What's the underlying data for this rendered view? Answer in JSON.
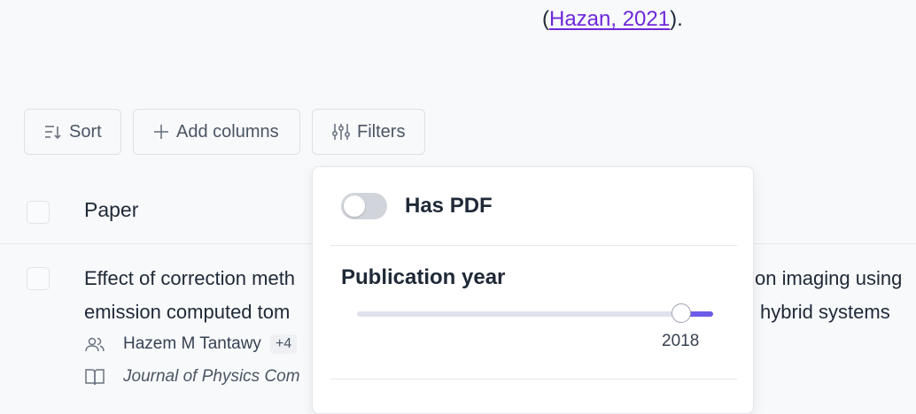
{
  "citation": {
    "open": "(",
    "link": "Hazan, 2021",
    "close": ")."
  },
  "toolbar": {
    "sort_label": "Sort",
    "add_columns_label": "Add columns",
    "filters_label": "Filters"
  },
  "table": {
    "column_paper": "Paper",
    "rows": [
      {
        "title_line1_start": "Effect of correction meth",
        "title_line1_end": "on imaging using",
        "title_line2_start": "emission computed tom",
        "title_line2_end": "hybrid systems",
        "author": "Hazem M Tantawy",
        "more_authors": "+4",
        "journal": "Journal of Physics Com"
      }
    ]
  },
  "filters_popover": {
    "has_pdf_label": "Has PDF",
    "has_pdf_enabled": false,
    "publication_year_label": "Publication year",
    "year_value": "2018",
    "slider_start_fraction": 0.91,
    "slider_end_fraction": 1.0
  },
  "colors": {
    "accent": "#6d5ce8",
    "link": "#6d28d9",
    "background": "#f8f9fb"
  },
  "icons": {
    "sort": "sort-icon",
    "add": "plus-icon",
    "filters": "sliders-icon",
    "authors": "users-icon",
    "journal": "book-icon"
  }
}
